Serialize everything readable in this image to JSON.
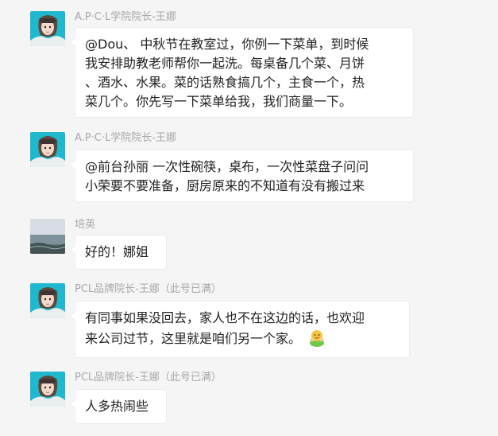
{
  "messages": [
    {
      "sender": "A.P·C·L学院院长-王娜",
      "avatar": "portrait-avatar",
      "lines": [
        "@Dou、 中秋节在教室过，你例一下菜单，到时候",
        "我安排助教老师帮你一起洗。每桌备几个菜、月饼",
        "、酒水、水果。菜的话熟食搞几个，主食一个，热",
        "菜几个。你先写一下菜单给我，我们商量一下。"
      ]
    },
    {
      "sender": "A.P·C·L学院院长-王娜",
      "avatar": "portrait-avatar",
      "lines": [
        "@前台孙丽 一次性碗筷，桌布，一次性菜盘子问问",
        "小荣要不要准备，厨房原来的不知道有没有搬过来"
      ]
    },
    {
      "sender": "培英",
      "avatar": "sea-avatar",
      "lines": [
        "好的！娜姐"
      ]
    },
    {
      "sender": "PCL品牌院长-王娜（此号已满）",
      "avatar": "portrait-avatar",
      "lines": [
        "有同事如果没回去，家人也不在这边的话，也欢迎",
        "来公司过节，这里就是咱们另一个家。"
      ],
      "emoji": "hug-emoji"
    },
    {
      "sender": "PCL品牌院长-王娜（此号已满）",
      "avatar": "portrait-avatar",
      "lines": [
        "人多热闹些"
      ]
    }
  ],
  "colors": {
    "background": "#f5f5f5",
    "bubble": "#ffffff",
    "sender_text": "#a8a8a8",
    "message_text": "#222222"
  }
}
